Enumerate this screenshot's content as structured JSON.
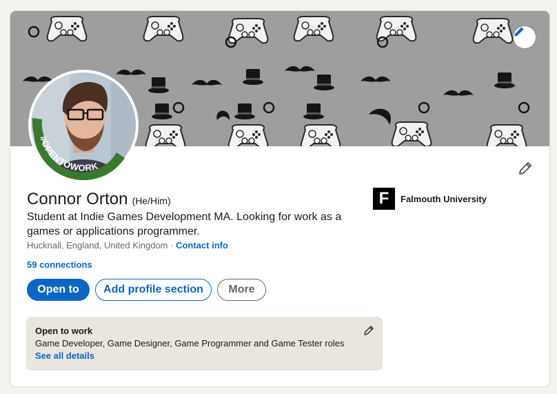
{
  "profile": {
    "name": "Connor Orton",
    "pronouns": "(He/Him)",
    "headline": "Student at Indie Games Development MA. Looking for work as a games or applications programmer.",
    "location": "Hucknall, England, United Kingdom",
    "separator": " · ",
    "contact_label": "Contact info",
    "connections": "59 connections",
    "open_to_work_ring": "#OPENTOWORK"
  },
  "actions": {
    "open_to": "Open to",
    "add_section": "Add profile section",
    "more": "More"
  },
  "education": {
    "logo_letter": "F",
    "school": "Falmouth University"
  },
  "open_to_work": {
    "title": "Open to work",
    "roles": "Game Developer, Game Designer, Game Programmer and Game Tester roles",
    "details_link": "See all details"
  },
  "icons": {
    "banner_edit": "pencil-icon",
    "intro_edit": "pencil-icon",
    "otw_edit": "pencil-icon"
  },
  "colors": {
    "accent": "#0a66c2",
    "banner_bg": "#9e9e9e",
    "open_to_work_green": "#3a7a2e"
  }
}
